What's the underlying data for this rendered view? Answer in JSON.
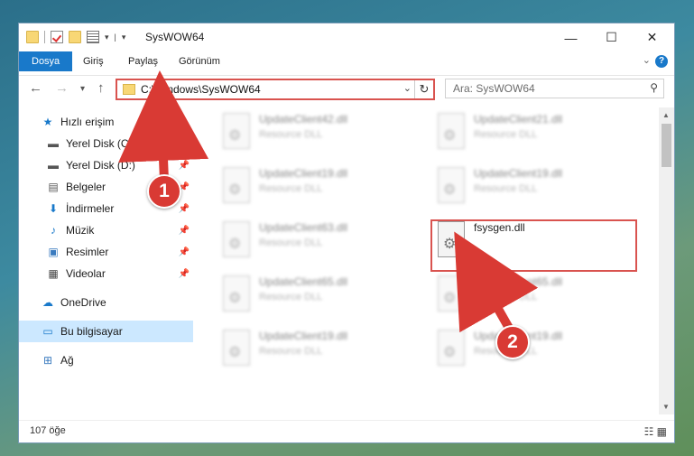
{
  "window": {
    "title": "SysWOW64",
    "controls": {
      "minimize": "—",
      "maximize": "☐",
      "close": "✕"
    }
  },
  "ribbon": {
    "tabs": [
      "Dosya",
      "Giriş",
      "Paylaş",
      "Görünüm"
    ],
    "help": "?"
  },
  "address": {
    "path": "C:\\Windows\\SysWOW64",
    "search_placeholder": "Ara: SysWOW64"
  },
  "nav_pane": {
    "items": [
      {
        "label": "Hızlı erişim",
        "icon": "star-icon"
      },
      {
        "label": "Yerel Disk (C:)",
        "icon": "drive-icon",
        "pinned": true
      },
      {
        "label": "Yerel Disk (D:)",
        "icon": "drive-icon",
        "pinned": true
      },
      {
        "label": "Belgeler",
        "icon": "documents-icon",
        "pinned": true
      },
      {
        "label": "İndirmeler",
        "icon": "download-icon",
        "pinned": true
      },
      {
        "label": "Müzik",
        "icon": "music-icon",
        "pinned": true
      },
      {
        "label": "Resimler",
        "icon": "pictures-icon",
        "pinned": true
      },
      {
        "label": "Videolar",
        "icon": "video-icon",
        "pinned": true
      },
      {
        "label": "OneDrive",
        "icon": "cloud-icon"
      },
      {
        "label": "Bu bilgisayar",
        "icon": "computer-icon",
        "selected": true
      },
      {
        "label": "Ağ",
        "icon": "network-icon"
      }
    ]
  },
  "files": [
    {
      "name": "UpdateClient42.dll",
      "desc": "Resource DLL"
    },
    {
      "name": "UpdateClient21.dll",
      "desc": "Resource DLL"
    },
    {
      "name": "UpdateClient19.dll",
      "desc": "Resource DLL"
    },
    {
      "name": "UpdateClient19.dll",
      "desc": "Resource DLL"
    },
    {
      "name": "UpdateClient63.dll",
      "desc": "Resource DLL"
    },
    {
      "name": "fsysgen.dll",
      "desc": ""
    },
    {
      "name": "UpdateClient65.dll",
      "desc": "Resource DLL"
    },
    {
      "name": "UpdateClient65.dll",
      "desc": "Resource DLL"
    },
    {
      "name": "UpdateClient19.dll",
      "desc": "Resource DLL"
    },
    {
      "name": "UpdateClient19.dll",
      "desc": "Resource DLL"
    }
  ],
  "status": {
    "count": "107 öğe"
  },
  "callouts": [
    "1",
    "2"
  ],
  "colors": {
    "accent": "#1979ca",
    "highlight": "#d9534f",
    "callout": "#d93a34"
  }
}
